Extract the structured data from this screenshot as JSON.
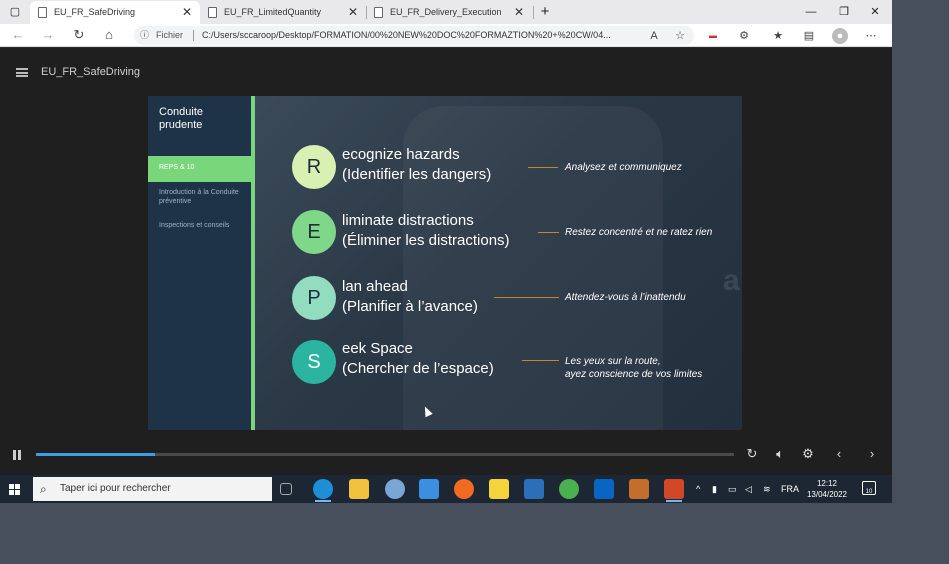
{
  "browser": {
    "tabs": [
      {
        "title": "EU_FR_SafeDriving",
        "active": true
      },
      {
        "title": "EU_FR_LimitedQuantity",
        "active": false
      },
      {
        "title": "EU_FR_Delivery_Execution",
        "active": false
      }
    ],
    "file_label": "Fichier",
    "url": "C:/Users/sccaroop/Desktop/FORMATION/00%20NEW%20DOC%20FORMAZTION%20+%20CW/04...",
    "icons": [
      "back-icon",
      "forward-icon",
      "refresh-icon",
      "home-icon",
      "info-icon",
      "read-aloud-icon",
      "add-favorite-icon",
      "extension-icon",
      "favorites-icon",
      "collections-icon",
      "profile-icon",
      "more-icon"
    ]
  },
  "player": {
    "course_title": "EU_FR_SafeDriving",
    "progress": 0.17
  },
  "slide": {
    "sidebar_title": "Conduite prudente",
    "active_item": "REPS & 10",
    "items": [
      "Introduction à la Conduite préventive",
      "Inspections et conseils"
    ],
    "watermark": "amazon",
    "rows": [
      {
        "letter": "R",
        "line1": "ecognize hazards",
        "line2": "(Identifier les dangers)",
        "note": "Analysez et communiquez",
        "color": "#d9f0b3"
      },
      {
        "letter": "E",
        "line1": "liminate distractions",
        "line2": "(Éliminer les distractions)",
        "note": "Restez concentré et ne ratez rien",
        "color": "#7fd88a"
      },
      {
        "letter": "P",
        "line1": "lan ahead",
        "line2": "(Planifier à l’avance)",
        "note": "Attendez-vous à l’inattendu",
        "color": "#92dcc0"
      },
      {
        "letter": "S",
        "line1": "eek Space",
        "line2": "(Chercher de l’espace)",
        "note": "Les yeux sur la route,\nayez conscience de vos limites",
        "color": "#2bb5a0"
      }
    ]
  },
  "taskbar": {
    "search_placeholder": "Taper ici pour rechercher",
    "language": "FRA",
    "time": "12:12",
    "date": "13/04/2022",
    "notifications": "10"
  }
}
